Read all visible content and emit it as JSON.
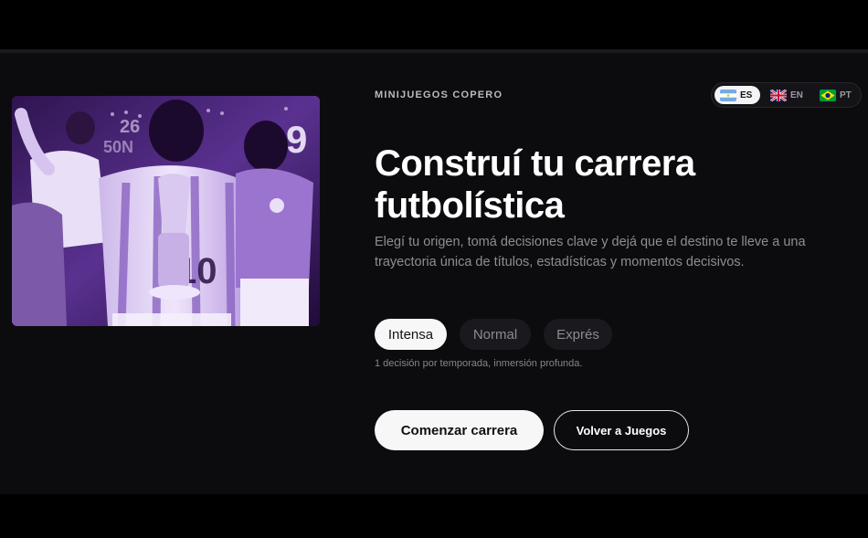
{
  "section": {
    "eyebrow": "MINIJUEGOS COPERO",
    "title": "Construí tu carrera futbolística",
    "description": "Elegí tu origen, tomá decisiones clave y dejá que el destino te lleve a una trayectoria única de títulos, estadísticas y momentos decisivos."
  },
  "languages": [
    {
      "code": "ES",
      "flag": "argentina-flag-icon",
      "active": true
    },
    {
      "code": "EN",
      "flag": "uk-flag-icon",
      "active": false
    },
    {
      "code": "PT",
      "flag": "brazil-flag-icon",
      "active": false
    }
  ],
  "modes": [
    {
      "label": "Intensa",
      "active": true
    },
    {
      "label": "Normal",
      "active": false
    },
    {
      "label": "Exprés",
      "active": false
    }
  ],
  "mode_hint": "1 decisión por temporada, inmersión profunda.",
  "actions": {
    "start": "Comenzar carrera",
    "back": "Volver a Juegos"
  },
  "colors": {
    "background": "#0c0c0e",
    "accent_purple": "#7b4fbf",
    "button_light": "#f7f7f8"
  }
}
